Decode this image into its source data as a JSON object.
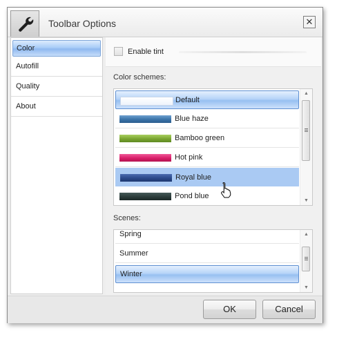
{
  "window": {
    "title": "Toolbar Options",
    "close_label": "✕",
    "icon": "wrench-icon"
  },
  "nav": {
    "items": [
      {
        "label": "Color",
        "selected": true
      },
      {
        "label": "Autofill",
        "selected": false
      },
      {
        "label": "Quality",
        "selected": false
      },
      {
        "label": "About",
        "selected": false
      }
    ]
  },
  "tint": {
    "label": "Enable tint",
    "checked": false
  },
  "color_schemes": {
    "label": "Color schemes:",
    "selected": "Default",
    "items": [
      {
        "label": "Default",
        "color": "#ffffff"
      },
      {
        "label": "Blue haze",
        "color": "#3a73a8"
      },
      {
        "label": "Bamboo green",
        "color": "#7aa531"
      },
      {
        "label": "Hot pink",
        "color": "#d81e6a"
      },
      {
        "label": "Royal blue",
        "color": "#2b4a8a"
      },
      {
        "label": "Pond blue",
        "color": "#2b3c3a"
      }
    ]
  },
  "scenes": {
    "label": "Scenes:",
    "selected": "Winter",
    "items": [
      {
        "label": "Spring"
      },
      {
        "label": "Summer"
      },
      {
        "label": "Winter"
      }
    ]
  },
  "footer": {
    "ok_label": "OK",
    "cancel_label": "Cancel"
  },
  "colors": {
    "selection_border": "#5e8fd1",
    "hover_row": "#aacaf3"
  }
}
